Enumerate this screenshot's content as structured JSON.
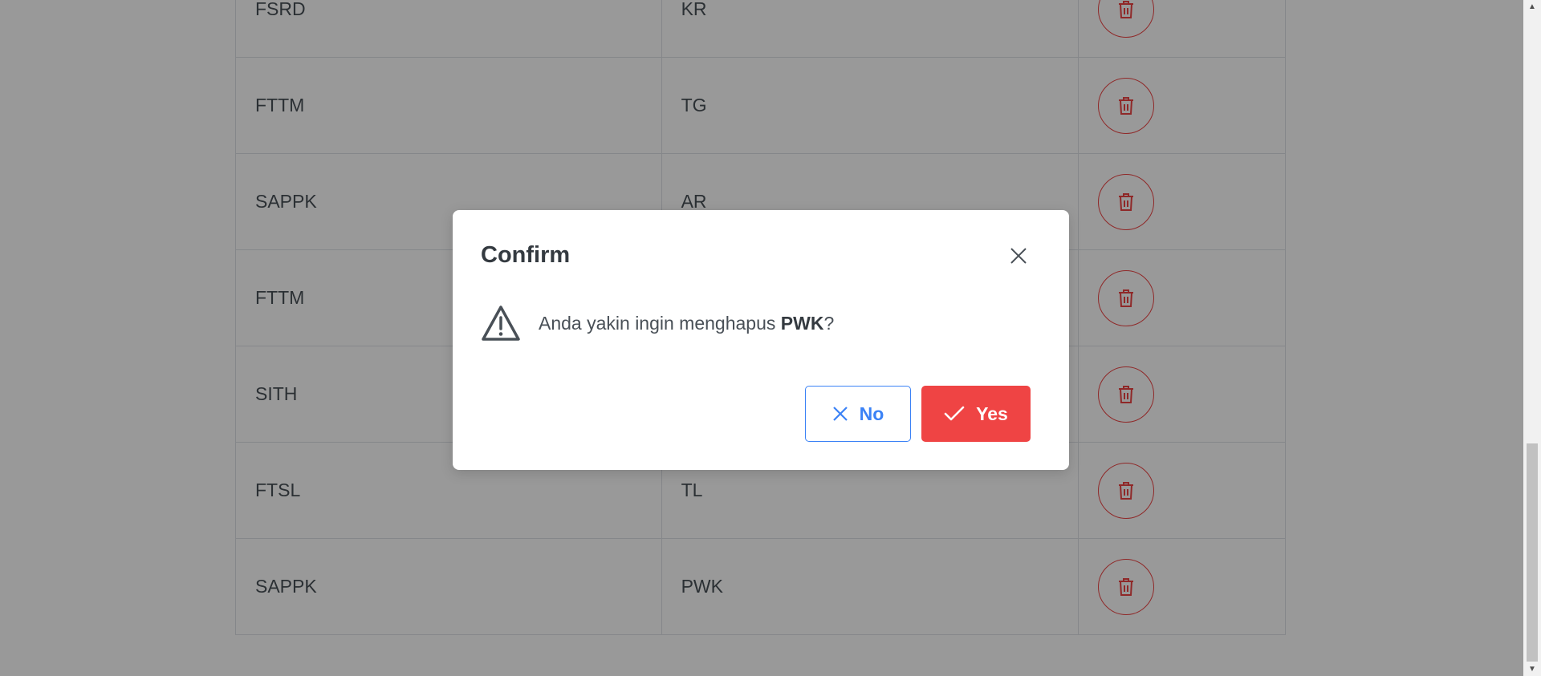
{
  "table": {
    "rows": [
      {
        "faculty": "FSRD",
        "code": "KR"
      },
      {
        "faculty": "FTTM",
        "code": "TG"
      },
      {
        "faculty": "SAPPK",
        "code": "AR"
      },
      {
        "faculty": "FTTM",
        "code": ""
      },
      {
        "faculty": "SITH",
        "code": ""
      },
      {
        "faculty": "FTSL",
        "code": "TL"
      },
      {
        "faculty": "SAPPK",
        "code": "PWK"
      }
    ]
  },
  "dialog": {
    "title": "Confirm",
    "message_prefix": "Anda yakin ingin menghapus ",
    "message_bold": "PWK",
    "message_suffix": "?",
    "no_label": "No",
    "yes_label": "Yes"
  },
  "colors": {
    "danger": "#ef4444",
    "primary": "#3b82f6",
    "overlay": "rgba(0,0,0,0.4)"
  },
  "icons": {
    "row_action": "trash-icon",
    "close": "close-icon",
    "warning": "warning-triangle-icon",
    "no": "x-icon",
    "yes": "check-icon"
  }
}
